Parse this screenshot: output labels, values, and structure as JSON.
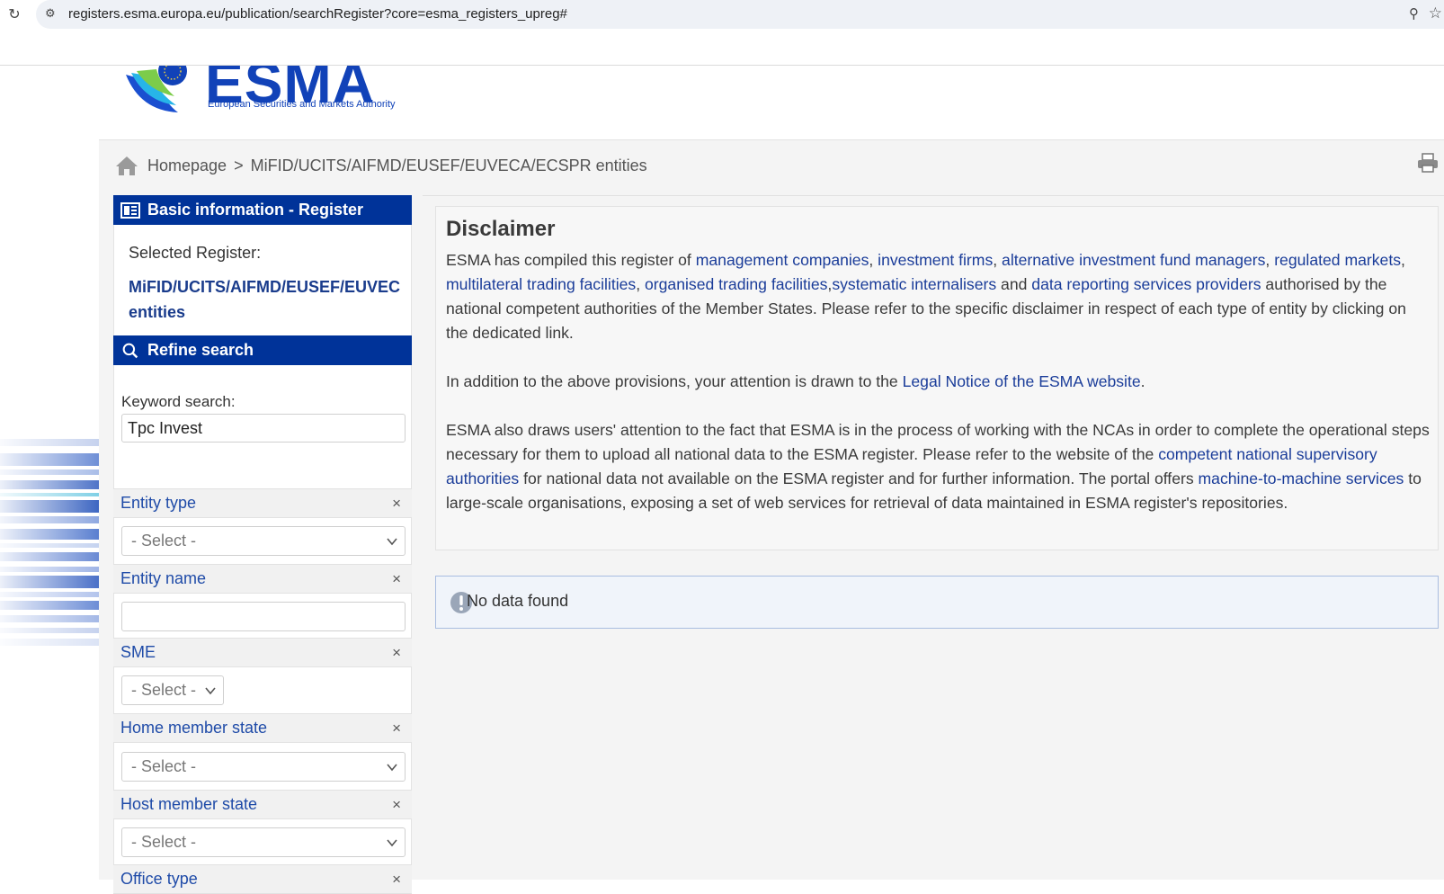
{
  "browser": {
    "url": "registers.esma.europa.eu/publication/searchRegister?core=esma_registers_upreg#"
  },
  "logo": {
    "word": "ESMA",
    "subtitle": "European Securities and Markets Authority"
  },
  "breadcrumb": {
    "home": "Homepage",
    "separator": ">",
    "current": "MiFID/UCITS/AIFMD/EUSEF/EUVECA/ECSPR entities"
  },
  "sidebar": {
    "basic_info_title": "Basic information - Register",
    "selected_register_label": "Selected Register:",
    "selected_register_line1": "MiFID/UCITS/AIFMD/EUSEF/EUVEC",
    "selected_register_line2": "entities",
    "refine_title": "Refine search",
    "keyword_label": "Keyword search:",
    "keyword_value": "Tpc Invest",
    "filters": [
      {
        "label": "Entity type",
        "type": "select",
        "value": "- Select -"
      },
      {
        "label": "Entity name",
        "type": "text",
        "value": ""
      },
      {
        "label": "SME",
        "type": "select",
        "value": "- Select -"
      },
      {
        "label": "Home member state",
        "type": "select",
        "value": "- Select -"
      },
      {
        "label": "Host member state",
        "type": "select",
        "value": "- Select -"
      },
      {
        "label": "Office type"
      }
    ],
    "clear_symbol": "×"
  },
  "disclaimer": {
    "title": "Disclaimer",
    "p1_a": "ESMA has compiled this register of ",
    "link_mgmt": "management companies",
    "link_inv": "investment firms",
    "link_aifm": "alternative investment fund managers",
    "link_rm": "regulated markets",
    "link_mtf": "multilateral trading facilities",
    "link_otf": "organised trading facilities",
    "link_si": "systematic internalisers",
    "p1_and": " and ",
    "link_drsp": "data reporting services providers",
    "p1_b": " authorised by the national competent authorities of the Member States. Please refer to the specific disclaimer in respect of each type of entity by clicking on the dedicated link.",
    "p2_a": "In addition to the above provisions, your attention is drawn to the ",
    "link_legal": "Legal Notice of the ESMA website",
    "p2_b": ".",
    "p3_a": "ESMA also draws users' attention to the fact that ESMA is in the process of working with the NCAs in order to complete the operational steps necessary for them to upload all national data to the ESMA register. Please refer to the website of the ",
    "link_nca": "competent national supervisory authorities",
    "p3_b": " for national data not available on the ESMA register and for further information. The portal offers ",
    "link_m2m": "machine-to-machine services",
    "p3_c": " to large-scale organisations, exposing a set of web services for retrieval of data maintained in ESMA register's repositories."
  },
  "results": {
    "message": "No data found"
  },
  "colors": {
    "header_blue": "#003399",
    "link_blue": "#1a3c99",
    "logo_blue": "#1142b8"
  },
  "icons": [
    "reload-icon",
    "site-info-icon",
    "zoom-icon",
    "star-icon",
    "home-icon",
    "print-icon",
    "register-icon",
    "search-icon",
    "clear-icon",
    "chevron-down-icon",
    "info-icon"
  ]
}
